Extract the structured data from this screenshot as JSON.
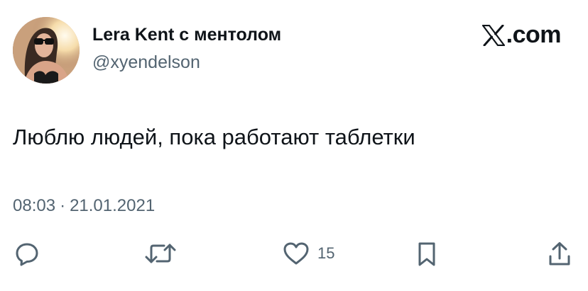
{
  "author": {
    "display_name": "Lera Kent с ментолом",
    "handle": "@xyendelson"
  },
  "brand": {
    "label": ".com"
  },
  "tweet": {
    "text": "Люблю людей, пока работают таблетки",
    "time": "08:03",
    "separator": "·",
    "date": "21.01.2021"
  },
  "actions": {
    "reply_icon": "reply-icon",
    "retweet_icon": "retweet-icon",
    "like_icon": "heart-icon",
    "like_count": "15",
    "bookmark_icon": "bookmark-icon",
    "share_icon": "share-icon"
  },
  "colors": {
    "text_primary": "#0f1419",
    "text_secondary": "#536471",
    "background": "#ffffff"
  }
}
